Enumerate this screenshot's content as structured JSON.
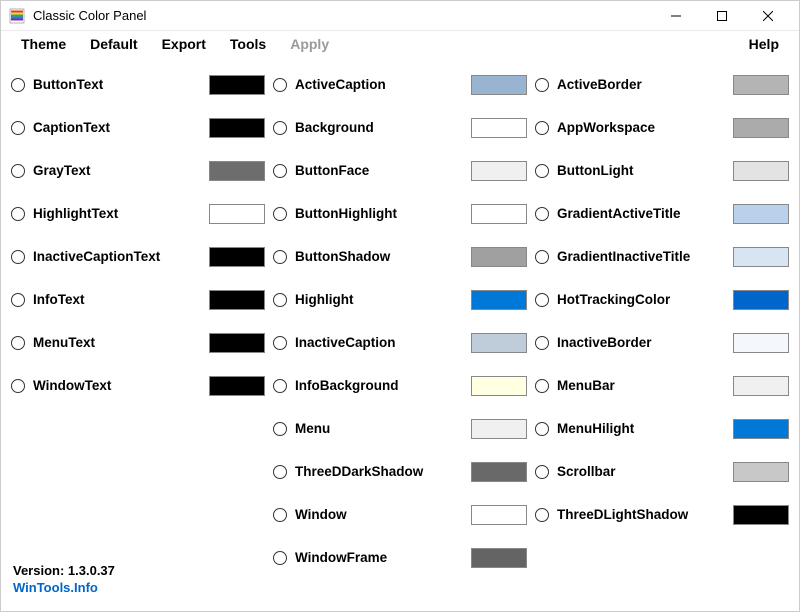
{
  "window": {
    "title": "Classic Color Panel"
  },
  "menu": {
    "theme": "Theme",
    "default": "Default",
    "export": "Export",
    "tools": "Tools",
    "apply": "Apply",
    "help": "Help"
  },
  "columns": [
    [
      {
        "name": "ButtonText",
        "color": "#000000"
      },
      {
        "name": "CaptionText",
        "color": "#000000"
      },
      {
        "name": "GrayText",
        "color": "#6d6d6d"
      },
      {
        "name": "HighlightText",
        "color": "#ffffff"
      },
      {
        "name": "InactiveCaptionText",
        "color": "#000000"
      },
      {
        "name": "InfoText",
        "color": "#000000"
      },
      {
        "name": "MenuText",
        "color": "#000000"
      },
      {
        "name": "WindowText",
        "color": "#000000"
      }
    ],
    [
      {
        "name": "ActiveCaption",
        "color": "#99b4d1"
      },
      {
        "name": "Background",
        "color": "#ffffff"
      },
      {
        "name": "ButtonFace",
        "color": "#f0f0f0"
      },
      {
        "name": "ButtonHighlight",
        "color": "#ffffff"
      },
      {
        "name": "ButtonShadow",
        "color": "#a0a0a0"
      },
      {
        "name": "Highlight",
        "color": "#0078d7"
      },
      {
        "name": "InactiveCaption",
        "color": "#bfcddb"
      },
      {
        "name": "InfoBackground",
        "color": "#ffffe1"
      },
      {
        "name": "Menu",
        "color": "#f0f0f0"
      },
      {
        "name": "ThreeDDarkShadow",
        "color": "#696969"
      },
      {
        "name": "Window",
        "color": "#ffffff"
      },
      {
        "name": "WindowFrame",
        "color": "#646464"
      }
    ],
    [
      {
        "name": "ActiveBorder",
        "color": "#b4b4b4"
      },
      {
        "name": "AppWorkspace",
        "color": "#ababab"
      },
      {
        "name": "ButtonLight",
        "color": "#e3e3e3"
      },
      {
        "name": "GradientActiveTitle",
        "color": "#b9d1ea"
      },
      {
        "name": "GradientInactiveTitle",
        "color": "#d7e4f2"
      },
      {
        "name": "HotTrackingColor",
        "color": "#0066cc"
      },
      {
        "name": "InactiveBorder",
        "color": "#f4f7fc"
      },
      {
        "name": "MenuBar",
        "color": "#f0f0f0"
      },
      {
        "name": "MenuHilight",
        "color": "#0078d7"
      },
      {
        "name": "Scrollbar",
        "color": "#c8c8c8"
      },
      {
        "name": "ThreeDLightShadow",
        "color": "#000000"
      }
    ]
  ],
  "footer": {
    "version_label": "Version: 1.3.0.37",
    "link": "WinTools.Info"
  }
}
